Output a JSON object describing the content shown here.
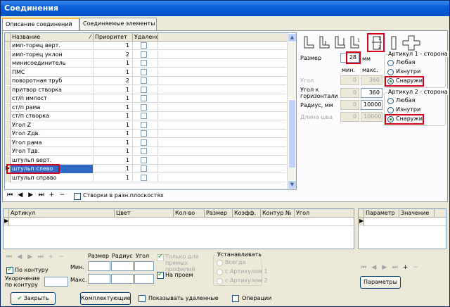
{
  "window": {
    "title": "Соединения"
  },
  "tabs": [
    {
      "label": "Описание соединений"
    },
    {
      "label": "Соединяемые элементы"
    }
  ],
  "connections_grid": {
    "columns": [
      "Название",
      "Приоритет",
      "Удалено"
    ],
    "rows": [
      {
        "name": "имп-торец верт.",
        "priority": "1"
      },
      {
        "name": "имп-торец уклон",
        "priority": "2"
      },
      {
        "name": "минисоединитель",
        "priority": "1"
      },
      {
        "name": "ПМС",
        "priority": "1"
      },
      {
        "name": "поворотная труб",
        "priority": "2"
      },
      {
        "name": "притвор створка",
        "priority": "1"
      },
      {
        "name": "ст/п импост",
        "priority": "1"
      },
      {
        "name": "ст/п рама",
        "priority": "1"
      },
      {
        "name": "ст/п створка",
        "priority": "1"
      },
      {
        "name": "Угол Z",
        "priority": "1"
      },
      {
        "name": "Угол Zдв.",
        "priority": "1"
      },
      {
        "name": "Угол рама",
        "priority": "1"
      },
      {
        "name": "Угол Тдв.",
        "priority": "1"
      },
      {
        "name": "штульп верт.",
        "priority": "1"
      },
      {
        "name": "штульп слево",
        "priority": "1"
      },
      {
        "name": "штульп справо",
        "priority": "1"
      }
    ]
  },
  "nav_top": {
    "glyphs": [
      "⏮",
      "◀",
      "▶",
      "⏭",
      "+",
      "−"
    ],
    "checkbox_label": "Створки в разн.плоскостях"
  },
  "params": {
    "size_label": "Размер",
    "size_value": "28",
    "size_unit": "мм",
    "min_label": "мин.",
    "max_label": "макс.",
    "angle_label": "Угол",
    "angle_min": "0",
    "angle_max": "360",
    "angle_horiz_label": "Угол к горизонтали",
    "horiz_min": "0",
    "horiz_max": "360",
    "radius_label": "Радиус, мм",
    "radius_min": "0",
    "radius_max": "10000",
    "seam_label": "Длина шва",
    "seam_min": "0",
    "seam_max": "10000"
  },
  "side1": {
    "title": "Артикул 1 - сторона",
    "options": [
      "Любая",
      "Изнутри",
      "Снаружи"
    ],
    "selected": "Снаружи"
  },
  "side2": {
    "title": "Артикул 2 - сторона",
    "options": [
      "Любая",
      "Изнутри",
      "Снаружи"
    ],
    "selected": "Снаружи"
  },
  "shape_icons": [
    "corner-left-icon",
    "corner-tee-icon",
    "corner-right-icon",
    "numbered-corner-icon",
    "overlap-icon",
    "vertical-bar-icon",
    "cross-icon"
  ],
  "article_grid": {
    "columns": [
      "Артикул",
      "Цвет",
      "Кол-во",
      "Размер",
      "Коэфф.",
      "Контур №",
      "Угол"
    ]
  },
  "param_grid": {
    "columns": [
      "Параметр",
      "Значение"
    ]
  },
  "bottom": {
    "nav_glyphs": [
      "⏮",
      "◀",
      "▶",
      "⏭",
      "+",
      "−"
    ],
    "size_label": "Размер",
    "radius_label": "Радиус",
    "angle_label": "Угол",
    "min_label": "Мин.",
    "max_label": "Макс.",
    "only_straight_label": "Только для прямых профилей",
    "on_opening_label": "На проем",
    "by_contour_label": "По контуру",
    "shorten_label": "Укорочение по контуру",
    "install_title": "Устанавливать",
    "install_options": [
      "Всегда",
      "с Артикулом 1",
      "с Артикулом 2"
    ],
    "params_button": "Параметры"
  },
  "footer": {
    "close_button": "Закрыть",
    "components_button": "Комплектующие",
    "show_deleted_label": "Показывать удаленные",
    "operations_label": "Операции"
  },
  "colors": {
    "highlight": "#d4001c",
    "selection": "#316ac5",
    "title_bar": "#0a5fd8"
  }
}
